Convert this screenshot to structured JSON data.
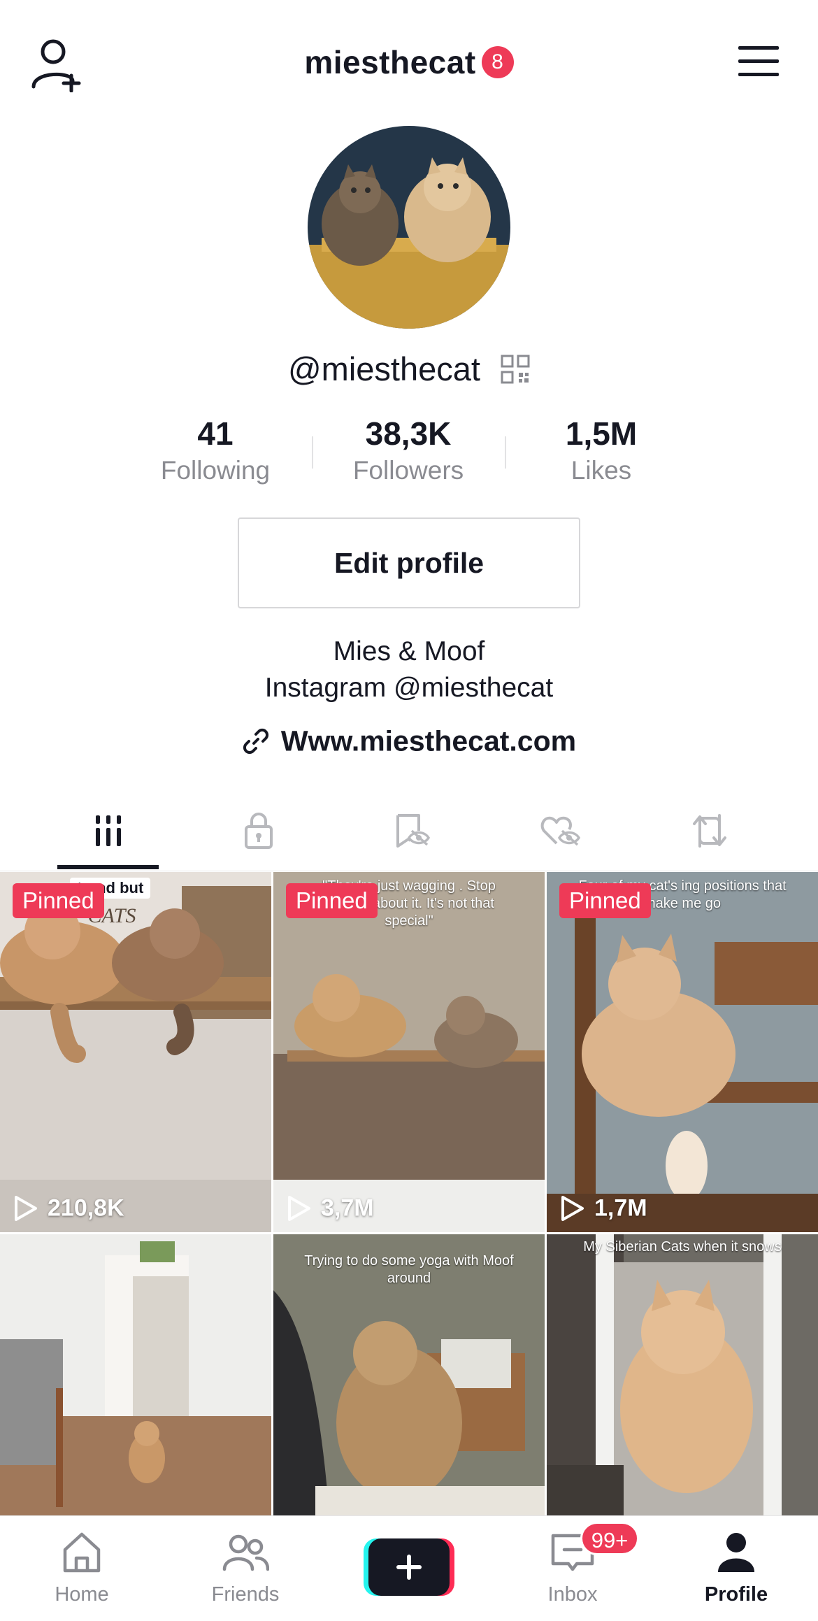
{
  "header": {
    "username": "miesthecat",
    "notification_count": "8"
  },
  "profile": {
    "handle": "@miesthecat",
    "stats": [
      {
        "value": "41",
        "label": "Following"
      },
      {
        "value": "38,3K",
        "label": "Followers"
      },
      {
        "value": "1,5M",
        "label": "Likes"
      }
    ],
    "edit_button": "Edit profile",
    "bio_line1": "Mies & Moof",
    "bio_line2": "Instagram @miesthecat",
    "website": "Www.miesthecat.com"
  },
  "tabs": [
    {
      "icon": "videos-grid-icon",
      "active": true
    },
    {
      "icon": "lock-icon",
      "active": false
    },
    {
      "icon": "bookmark-hidden-icon",
      "active": false
    },
    {
      "icon": "liked-hidden-icon",
      "active": false
    },
    {
      "icon": "repost-icon",
      "active": false
    }
  ],
  "videos": [
    {
      "pinned": "Pinned",
      "views": "210,8K",
      "caption": "trend but",
      "caption2": "CATS"
    },
    {
      "pinned": "Pinned",
      "views": "3,7M",
      "caption": "\"They're just wagging . Stop posting about it. It's not that special\""
    },
    {
      "pinned": "Pinned",
      "views": "1,7M",
      "caption": "Four of my cat's ing positions that make me go"
    },
    {
      "caption": ""
    },
    {
      "caption": "Trying to do some yoga with Moof around"
    },
    {
      "caption": "My Siberian Cats when it snows"
    }
  ],
  "bottom_nav": {
    "items": [
      {
        "label": "Home",
        "active": false
      },
      {
        "label": "Friends",
        "active": false
      },
      {
        "label": "",
        "active": false
      },
      {
        "label": "Inbox",
        "active": false
      },
      {
        "label": "Profile",
        "active": true
      }
    ],
    "inbox_badge": "99+"
  },
  "colors": {
    "accent": "#ee3a57",
    "text": "#161823",
    "muted": "#8a8b91"
  }
}
